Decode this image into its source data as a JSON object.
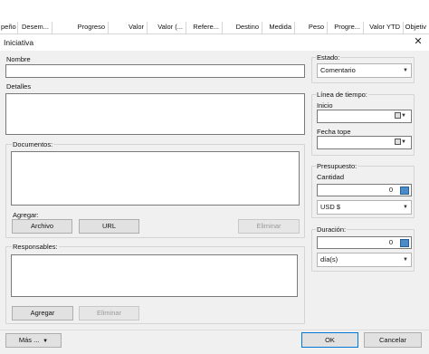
{
  "grid": {
    "columns": [
      "peño",
      "Desem...",
      "Progreso",
      "Valor",
      "Valor (...",
      "Refere...",
      "Destino",
      "Medida",
      "Peso",
      "Progre...",
      "Valor YTD",
      "Objetiv"
    ]
  },
  "dialog": {
    "title": "Iniciativa",
    "close_glyph": "✕",
    "nombre_label": "Nombre",
    "nombre_value": "",
    "detalles_label": "Detalles",
    "detalles_value": "",
    "documentos": {
      "title": "Documentos:",
      "agregar_label": "Agregar:",
      "archivo_button": "Archivo",
      "url_button": "URL",
      "eliminar_button": "Eliminar"
    },
    "responsables": {
      "title": "Responsables:",
      "agregar_button": "Agregar",
      "eliminar_button": "Eliminar"
    },
    "estado": {
      "title": "Estado:",
      "selected": "Comentario"
    },
    "timeline": {
      "title": "Línea de tiempo:",
      "inicio_label": "Inicio",
      "inicio_value": "",
      "fecha_tope_label": "Fecha tope",
      "fecha_tope_value": ""
    },
    "presupuesto": {
      "title": "Presupuesto:",
      "cantidad_label": "Cantidad",
      "cantidad_value": "0",
      "currency": "USD $"
    },
    "duracion": {
      "title": "Duración:",
      "value": "0",
      "unit": "día(s)"
    },
    "footer": {
      "mas_button": "Más ...",
      "ok_button": "OK",
      "cancel_button": "Cancelar"
    }
  }
}
